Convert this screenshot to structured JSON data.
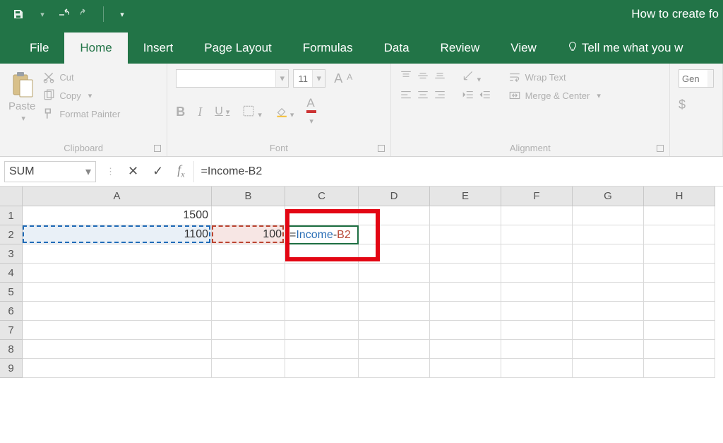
{
  "title": "How to create fo",
  "tabs": {
    "file": "File",
    "home": "Home",
    "insert": "Insert",
    "page_layout": "Page Layout",
    "formulas": "Formulas",
    "data": "Data",
    "review": "Review",
    "view": "View",
    "tellme": "Tell me what you w"
  },
  "ribbon": {
    "clipboard": {
      "paste": "Paste",
      "cut": "Cut",
      "copy": "Copy",
      "painter": "Format Painter",
      "title": "Clipboard"
    },
    "font": {
      "size": "11",
      "title": "Font"
    },
    "alignment": {
      "wrap": "Wrap Text",
      "merge": "Merge & Center",
      "title": "Alignment"
    },
    "number": {
      "fmt": "Gen"
    }
  },
  "formula_bar": {
    "name": "SUM",
    "formula": "=Income-B2"
  },
  "columns": [
    "A",
    "B",
    "C",
    "D",
    "E",
    "F",
    "G",
    "H"
  ],
  "cells": {
    "A1": "1500",
    "A2": "1100",
    "B2": "100",
    "C2_eq": "=",
    "C2_ref1": "Income",
    "C2_op": "-",
    "C2_ref2": "B2"
  },
  "row_count": 9
}
